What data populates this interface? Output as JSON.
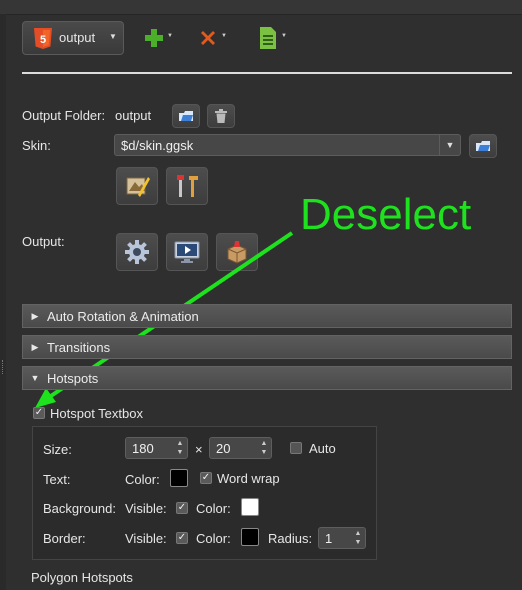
{
  "toolbar": {
    "output_select": "output",
    "add_icon": "add-icon",
    "remove_icon": "remove-icon",
    "document_icon": "document-icon"
  },
  "output_folder": {
    "label": "Output Folder:",
    "value": "output"
  },
  "skin": {
    "label": "Skin:",
    "value": "$d/skin.ggsk"
  },
  "output": {
    "label": "Output:"
  },
  "sections": [
    {
      "label": "Auto Rotation & Animation",
      "expanded": false
    },
    {
      "label": "Transitions",
      "expanded": false
    },
    {
      "label": "Hotspots",
      "expanded": true
    }
  ],
  "hotspot_textbox": {
    "label": "Hotspot Textbox",
    "checked": true,
    "size_label": "Size:",
    "width": "180",
    "times": "×",
    "height": "20",
    "auto_label": "Auto",
    "text_label": "Text:",
    "color_label": "Color:",
    "word_wrap_label": "Word wrap",
    "background_label": "Background:",
    "visible_label": "Visible:",
    "border_label": "Border:",
    "radius_label": "Radius:",
    "radius": "1"
  },
  "polygon_hotspots": "Polygon Hotspots",
  "annotation": "Deselect",
  "colors": {
    "annotation": "#1ee21e",
    "html5": "#e44d26",
    "add": "#4caf2a",
    "remove": "#e25a1c",
    "doc": "#7cc242"
  }
}
